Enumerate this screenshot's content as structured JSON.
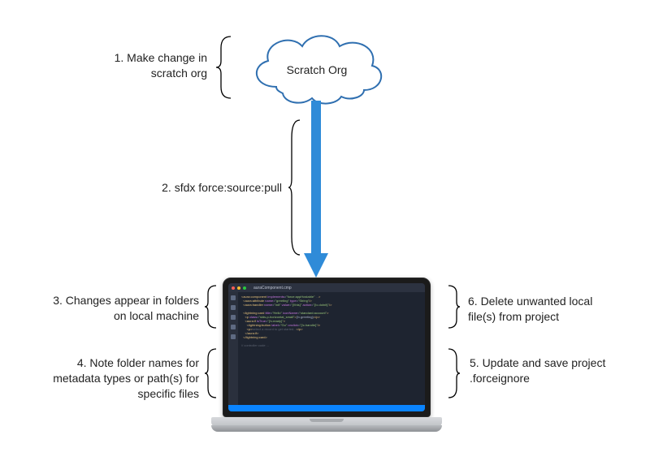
{
  "cloud": {
    "label": "Scratch Org"
  },
  "labels": {
    "step1": "1. Make change in scratch org",
    "step2": "2. sfdx force:source:pull",
    "step3": "3. Changes appear in folders on local machine",
    "step4": "4. Note folder names for metadata types or path(s) for specific files",
    "step5": "5. Update and save project .forceignore",
    "step6": "6. Delete unwanted local file(s) from project"
  },
  "editor": {
    "tab": "auraComponent.cmp"
  }
}
